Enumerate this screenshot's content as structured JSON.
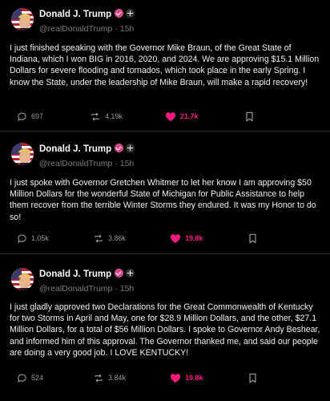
{
  "author": {
    "name": "Donald J. Trump",
    "handle": "@realDonaldTrump"
  },
  "posts": [
    {
      "time": "15h",
      "text": "I just finished speaking with the Governor Mike Braun, of the Great State of Indiana, which I won BIG in 2016, 2020, and 2024. We are approving $15.1 Million Dollars for severe flooding and tornados, which took place in the early Spring. I know the State, under the leadership of Mike Braun, will make a rapid recovery!",
      "replies": "697",
      "reposts": "4.19k",
      "likes": "21.7k"
    },
    {
      "time": "15h",
      "text": "I just spoke with Governor Gretchen Whitmer to let her know I am approving $50 Million Dollars for the wonderful State of Michigan for Public Assistance to help them recover from the terrible Winter Storms they endured. It was my Honor to do so!",
      "replies": "1.05k",
      "reposts": "3.86k",
      "likes": "19.8k"
    },
    {
      "time": "15h",
      "text": "I just gladly approved two Declarations for the Great Commonwealth of Kentucky for two Storms in April and May, one for $28.9 Million Dollars, and the other, $27.1 Million Dollars, for a total of $56 Million Dollars. I spoke to Governor Andy Beshear, and informed him of this approval. The Governor thanked me, and said our people are doing a very good job. I LOVE KENTUCKY!",
      "replies": "524",
      "reposts": "3.84k",
      "likes": "19.8k"
    }
  ],
  "separator": "·",
  "colors": {
    "background": "#000000",
    "like": "#f91880",
    "verified_badge": "#d94a8c",
    "muted_text": "#7d7d7d"
  },
  "icons": [
    "reply-icon",
    "repost-icon",
    "like-heart-icon",
    "bookmark-icon",
    "verified-badge-icon",
    "plus-badge-icon"
  ]
}
